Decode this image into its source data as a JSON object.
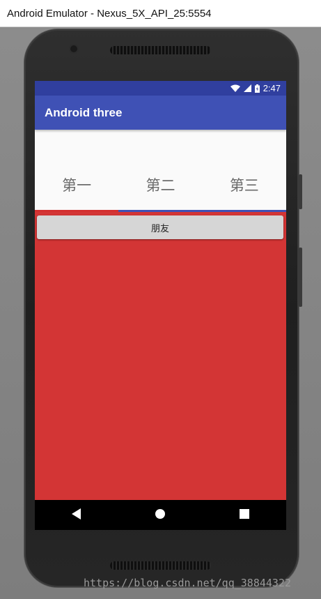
{
  "window": {
    "title": "Android Emulator - Nexus_5X_API_25:5554"
  },
  "status_bar": {
    "time": "2:47",
    "icons": [
      "wifi-icon",
      "signal-icon",
      "battery-icon"
    ]
  },
  "app_bar": {
    "title": "Android three"
  },
  "tabs": [
    {
      "label": "第一",
      "selected": false
    },
    {
      "label": "第二",
      "selected": true
    },
    {
      "label": "第三",
      "selected": false
    }
  ],
  "content": {
    "button_label": "朋友",
    "background_color": "#d33535"
  },
  "nav_bar": {
    "buttons": [
      "back-icon",
      "home-icon",
      "recents-icon"
    ]
  },
  "colors": {
    "primary": "#3f51b5",
    "primary_dark": "#303f9f",
    "accent": "#d33535"
  },
  "watermark": "https://blog.csdn.net/qq_38844322"
}
